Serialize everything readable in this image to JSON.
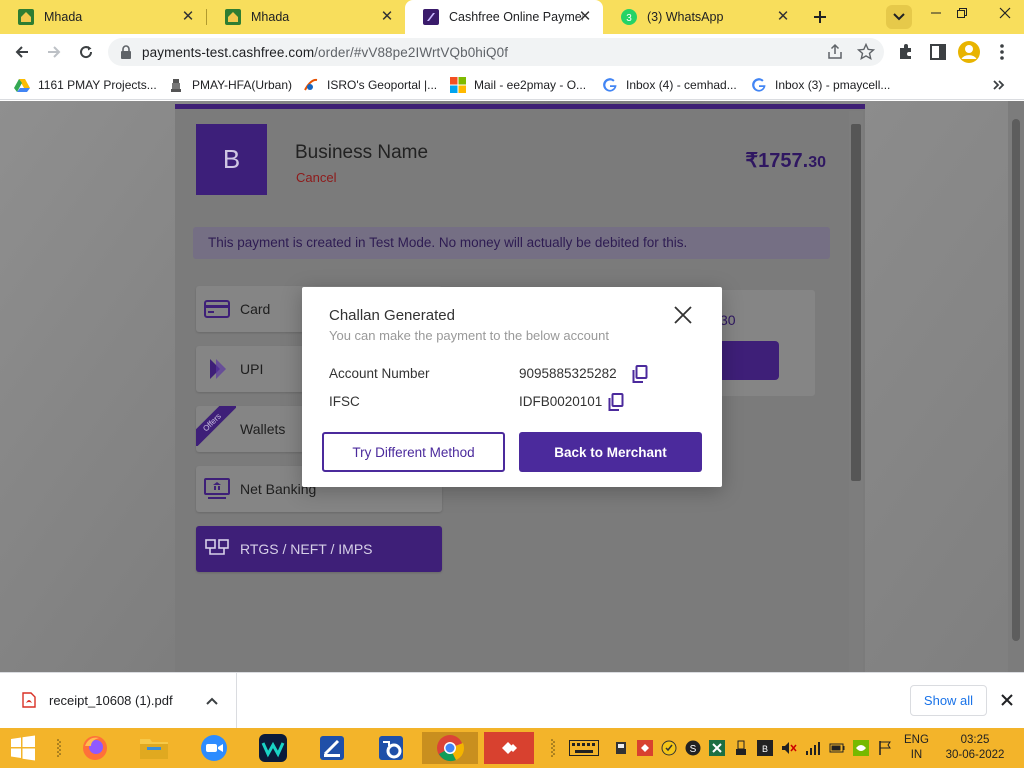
{
  "browser": {
    "tabs": [
      {
        "title": "Mhada",
        "active": false
      },
      {
        "title": "Mhada",
        "active": false
      },
      {
        "title": "Cashfree Online Payment",
        "active": true
      },
      {
        "title": "(3) WhatsApp",
        "active": false
      }
    ],
    "url_host": "payments-test.cashfree.com",
    "url_path": "/order/#vV88pe2IWrtVQb0hiQ0f",
    "bookmarks": [
      "1161 PMAY Projects...",
      "PMAY-HFA(Urban)",
      "ISRO's Geoportal |...",
      "Mail - ee2pmay - O...",
      "Inbox (4) - cemhad...",
      "Inbox (3) - pmaycell..."
    ]
  },
  "checkout": {
    "avatar_letter": "B",
    "business_name": "Business Name",
    "cancel_label": "Cancel",
    "amount_main": "₹1757.",
    "amount_decimal": "30",
    "test_mode_notice": "This payment is created in Test Mode. No money will actually be debited for this.",
    "methods": [
      {
        "label": "Card"
      },
      {
        "label": "UPI"
      },
      {
        "label": "Wallets",
        "ribbon": "Offers"
      },
      {
        "label": "Net Banking"
      },
      {
        "label": "RTGS / NEFT / IMPS",
        "active": true
      }
    ],
    "right_panel_amount_fragment": "30"
  },
  "modal": {
    "title": "Challan Generated",
    "subtitle": "You can make the payment to the below account",
    "account_label": "Account Number",
    "account_value": "9095885325282",
    "ifsc_label": "IFSC",
    "ifsc_value": "IDFB0020101",
    "try_different_label": "Try Different Method",
    "back_label": "Back to Merchant"
  },
  "downloads": {
    "file_name": "receipt_10608 (1).pdf",
    "show_all_label": "Show all"
  },
  "taskbar": {
    "lang_line1": "ENG",
    "lang_line2": "IN",
    "time": "03:25",
    "date": "30-06-2022"
  },
  "colors": {
    "tabstrip": "#f8de5c",
    "brand_purple": "#4b2a9c",
    "taskbar": "#f3b42a"
  }
}
